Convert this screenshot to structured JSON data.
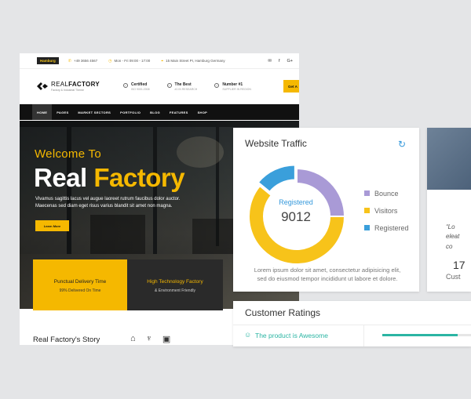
{
  "site": {
    "topbar": {
      "lang": "Hamburg",
      "phone": "+49 3656 4567",
      "hours": "Mon - Fri 09:00 - 17:00",
      "address": "15 Main Street PI, Hamburg Germany"
    },
    "logo": {
      "name_light": "REAL",
      "name_bold": "FACTORY",
      "tagline": "Factory & Industrial Theme"
    },
    "features": [
      {
        "title": "Certified",
        "sub": "ISO 9001:2008"
      },
      {
        "title": "The Best",
        "sub": "#1 IN RESEARCH"
      },
      {
        "title": "Number #1",
        "sub": "SUPPLIER IN REGION"
      }
    ],
    "cta": "Get A",
    "nav": [
      "HOME",
      "PAGES",
      "MARKET SECTORS",
      "PORTFOLIO",
      "BLOG",
      "FEATURES",
      "SHOP"
    ],
    "hero": {
      "welcome": "Welcome To",
      "title_white": "Real",
      "title_yellow": "Factory",
      "desc_line1": "Vivamus sagittis lacus vel augue laoreet rutrum faucibus dolor auctor.",
      "desc_line2": "Maecenas sed diam eget risus varius blandit sit amet non magna.",
      "button": "Learn More"
    },
    "cards": [
      {
        "title": "Punctual Delivery Time",
        "sub": "99% Delivered On Time"
      },
      {
        "title": "High Technology Factory",
        "sub": "& Environment Friendly"
      }
    ],
    "story": "Real Factory's Story"
  },
  "traffic": {
    "title": "Website Traffic",
    "center_label": "Registered",
    "center_value": "9012",
    "legend": [
      {
        "label": "Bounce",
        "color": "#a99ad6"
      },
      {
        "label": "Visitors",
        "color": "#f7c31a"
      },
      {
        "label": "Registered",
        "color": "#3a9fdb"
      }
    ],
    "shares": [
      0.25,
      0.61,
      0.14
    ],
    "para_line1": "Lorem ipsum dolor sit amet, consectetur adipisicing elit,",
    "para_line2": "sed do eiusmod tempor incididunt ut labore et dolore."
  },
  "side": {
    "quote_line1": "“Lo",
    "quote_line2": "eleat",
    "quote_line3": "co",
    "num": "17",
    "caption": "Cust"
  },
  "ratings": {
    "title": "Customer Ratings",
    "item": "The product is Awesome",
    "fill": 0.85
  }
}
